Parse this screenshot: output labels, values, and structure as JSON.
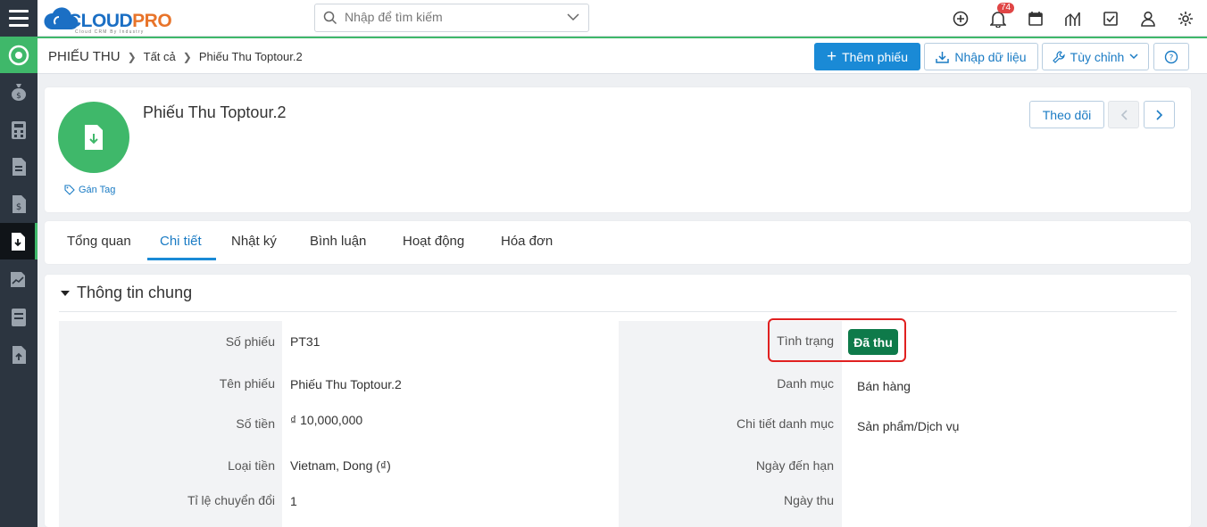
{
  "app": {
    "logo_cloud": "CLOUD",
    "logo_pro": "PRO",
    "logo_tagline": "Cloud CRM By Industry"
  },
  "search": {
    "placeholder": "Nhập để tìm kiếm"
  },
  "notifications": {
    "count": "74"
  },
  "breadcrumb": {
    "module": "PHIẾU THU",
    "items": [
      "Tất cả",
      "Phiếu Thu Toptour.2"
    ]
  },
  "toolbar": {
    "add_label": "Thêm phiếu",
    "import_label": "Nhập dữ liệu",
    "customize_label": "Tùy chỉnh"
  },
  "record": {
    "title": "Phiếu Thu Toptour.2",
    "tag_label": "Gán Tag",
    "follow_label": "Theo dõi"
  },
  "tabs": [
    {
      "label": "Tổng quan"
    },
    {
      "label": "Chi tiết"
    },
    {
      "label": "Nhật ký"
    },
    {
      "label": "Bình luận"
    },
    {
      "label": "Hoạt động"
    },
    {
      "label": "Hóa đơn"
    }
  ],
  "section": {
    "title": "Thông tin chung",
    "left_fields": [
      {
        "label": "Số phiếu",
        "value": "PT31"
      },
      {
        "label": "Tên phiếu",
        "value": "Phiếu Thu Toptour.2"
      },
      {
        "label": "Số tiền",
        "value": "₫ 10,000,000"
      },
      {
        "label": "Loại tiền",
        "value": "Vietnam, Dong (₫)"
      },
      {
        "label": "Tỉ lệ chuyển đổi",
        "value": "1"
      }
    ],
    "right_fields": [
      {
        "label": "Tình trạng",
        "value": "Đã thu"
      },
      {
        "label": "Danh mục",
        "value": "Bán hàng"
      },
      {
        "label": "Chi tiết danh mục",
        "value": "Sản phẩm/Dịch vụ"
      },
      {
        "label": "Ngày đến hạn",
        "value": ""
      },
      {
        "label": "Ngày thu",
        "value": ""
      }
    ]
  },
  "colors": {
    "accent": "#1a8ad6",
    "brand_green": "#3fb86a",
    "status_paid": "#0e7a4a",
    "highlight": "#e02020"
  }
}
